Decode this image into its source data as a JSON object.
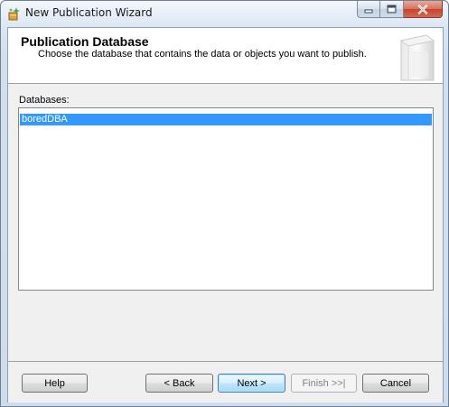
{
  "window": {
    "title": "New Publication Wizard"
  },
  "header": {
    "title": "Publication Database",
    "description": "Choose the database that contains the data or objects you want to publish."
  },
  "databases": {
    "label": "Databases:",
    "items": [
      {
        "name": "boredDBA",
        "selected": true
      }
    ]
  },
  "buttons": {
    "help": "Help",
    "back": "< Back",
    "next": "Next >",
    "finish": "Finish >>|",
    "cancel": "Cancel"
  },
  "colors": {
    "selection": "#3399ff",
    "close_button": "#c7442b"
  }
}
